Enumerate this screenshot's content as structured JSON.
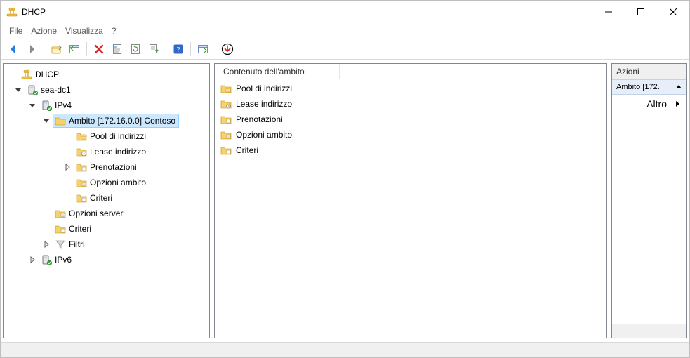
{
  "window": {
    "title": "DHCP"
  },
  "menu": {
    "file": "File",
    "action": "Azione",
    "view": "Visualizza",
    "help": "?"
  },
  "tree": {
    "root": "DHCP",
    "server": "sea-dc1",
    "ipv4": "IPv4",
    "scope": "Ambito [172.16.0.0] Contoso",
    "scope_children": {
      "pool": "Pool di indirizzi",
      "leases": "Lease indirizzo",
      "reservations": "Prenotazioni",
      "scope_options": "Opzioni ambito",
      "policies": "Criteri"
    },
    "server_options": "Opzioni server",
    "server_policies": "Criteri",
    "filters": "Filtri",
    "ipv6": "IPv6"
  },
  "list": {
    "header": "Contenuto dell'ambito",
    "items": {
      "pool": "Pool di indirizzi",
      "leases": "Lease indirizzo",
      "reservations": "Prenotazioni",
      "scope_options": "Opzioni ambito",
      "policies": "Criteri"
    }
  },
  "actions": {
    "header": "Azioni",
    "group": "Ambito [172.",
    "more": "Altro"
  }
}
